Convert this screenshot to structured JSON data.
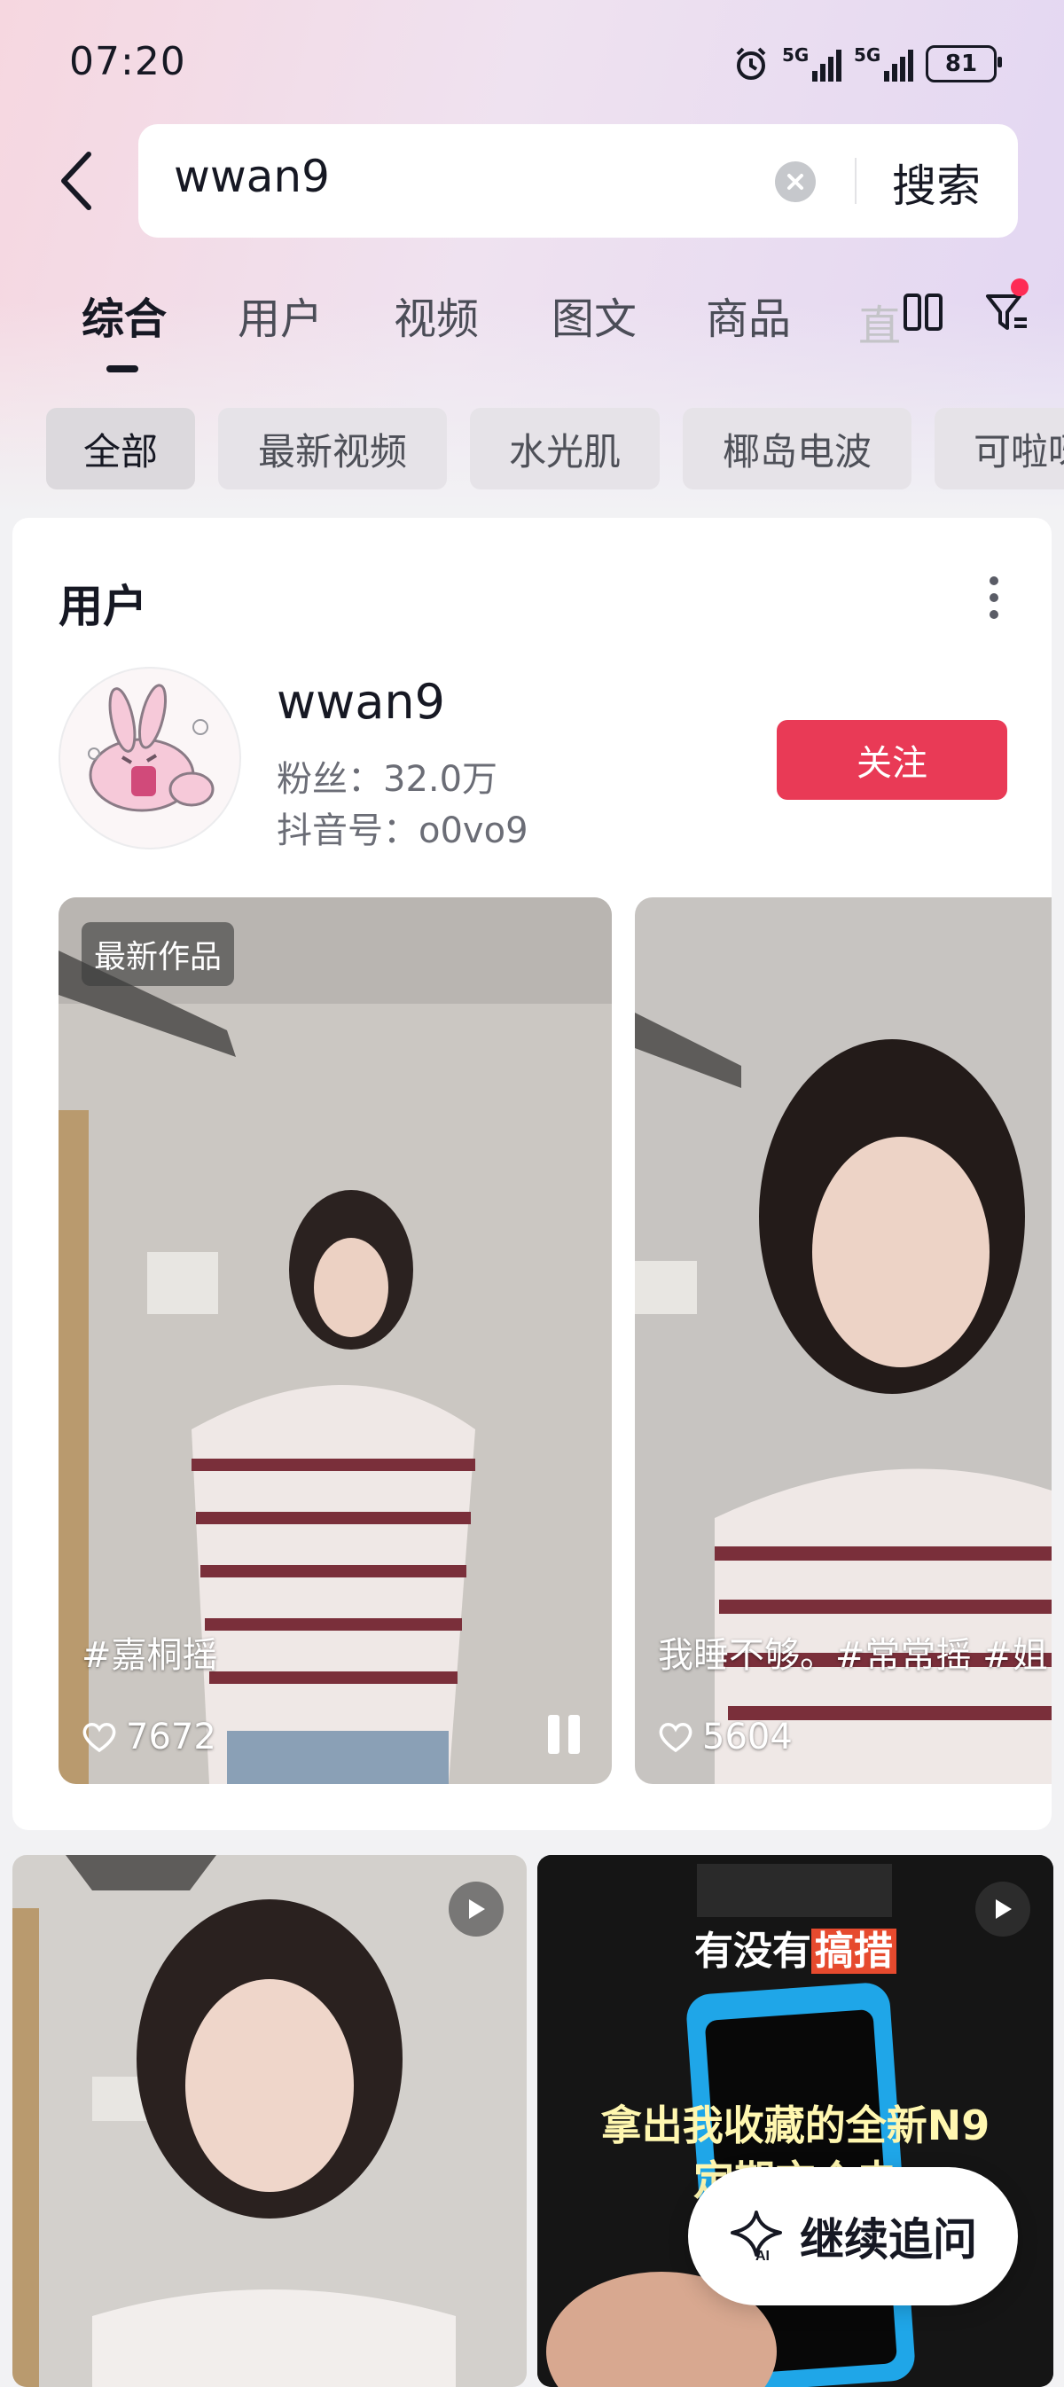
{
  "status_bar": {
    "time": "07:20",
    "network1": "5G",
    "network2": "5G",
    "battery": "81"
  },
  "search": {
    "query": "wwan9",
    "button_label": "搜索"
  },
  "tabs": [
    {
      "label": "综合",
      "active": true
    },
    {
      "label": "用户"
    },
    {
      "label": "视频"
    },
    {
      "label": "图文"
    },
    {
      "label": "商品"
    }
  ],
  "tab_overflow": "直",
  "chips": [
    {
      "label": "全部",
      "active": true
    },
    {
      "label": "最新视频"
    },
    {
      "label": "水光肌"
    },
    {
      "label": "椰岛电波"
    },
    {
      "label": "可啦呀"
    }
  ],
  "user_section": {
    "title": "用户",
    "username": "wwan9",
    "fans": "粉丝：32.0万",
    "douyin_id": "抖音号：o0vo9",
    "follow_label": "关注"
  },
  "videos": [
    {
      "badge": "最新作品",
      "caption": "#嘉桐摇",
      "likes": "7672",
      "state": "playing"
    },
    {
      "caption": "我睡不够。#常常摇 #姐",
      "likes": "5604"
    }
  ],
  "grid_tiles": [
    {
      "type": "video"
    },
    {
      "type": "video",
      "title_pre": "有没有",
      "title_hl": "搞措",
      "subtitle_line1": "拿出我收藏的全新N9",
      "subtitle_line2": "定期充个电"
    }
  ],
  "ai_button": {
    "label": "继续追问",
    "icon_text": "AI"
  },
  "colors": {
    "accent": "#fe2c55",
    "follow": "#e93a56"
  }
}
